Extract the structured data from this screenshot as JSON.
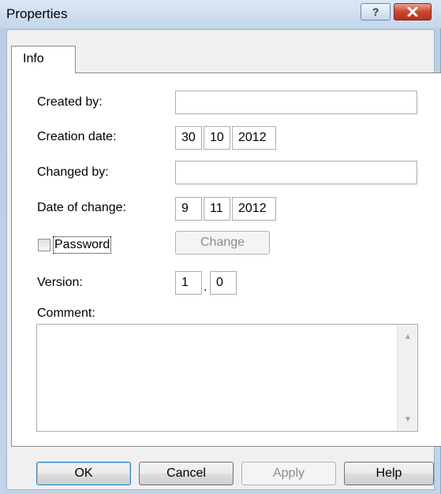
{
  "window": {
    "title": "Properties"
  },
  "titlebar": {
    "help_glyph": "?",
    "close_glyph": "✕"
  },
  "tabs": [
    {
      "label": "Info"
    }
  ],
  "form": {
    "created_by": {
      "label": "Created by:",
      "value": ""
    },
    "creation_date": {
      "label": "Creation date:",
      "day": "30",
      "month": "10",
      "year": "2012"
    },
    "changed_by": {
      "label": "Changed by:",
      "value": ""
    },
    "date_of_change": {
      "label": "Date of change:",
      "day": "9",
      "month": "11",
      "year": "2012"
    },
    "password": {
      "label": "Password",
      "checked": false,
      "change_button": "Change"
    },
    "version": {
      "label": "Version:",
      "major": "1",
      "separator": ".",
      "minor": "0"
    },
    "comment": {
      "label": "Comment:",
      "value": ""
    }
  },
  "buttons": {
    "ok": "OK",
    "cancel": "Cancel",
    "apply": "Apply",
    "help": "Help"
  },
  "icons": {
    "help": "help-icon",
    "close": "close-icon",
    "scroll_up": "scroll-up-arrow-icon",
    "scroll_down": "scroll-down-arrow-icon"
  }
}
